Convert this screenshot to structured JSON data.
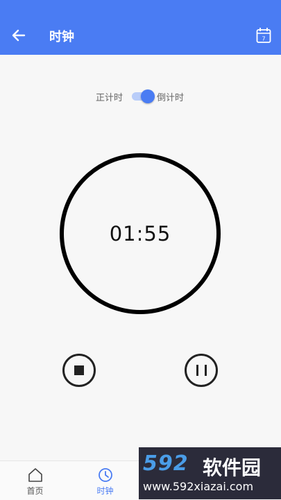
{
  "header": {
    "title": "时钟"
  },
  "mode": {
    "left_label": "正计时",
    "right_label": "倒计时",
    "countdown_enabled": true
  },
  "timer": {
    "display": "01:55"
  },
  "bottom_nav": {
    "items": [
      {
        "label": "首页"
      },
      {
        "label": "时钟",
        "active": true
      }
    ]
  },
  "watermark": {
    "logo_a": "592",
    "logo_b": "软件园",
    "url": "www.592xiazai.com"
  },
  "colors": {
    "primary": "#4a7cf3",
    "background": "#f7f7f7"
  },
  "icons": [
    "back-arrow-icon",
    "calendar-icon",
    "stop-icon",
    "pause-icon",
    "home-icon",
    "clock-icon"
  ]
}
